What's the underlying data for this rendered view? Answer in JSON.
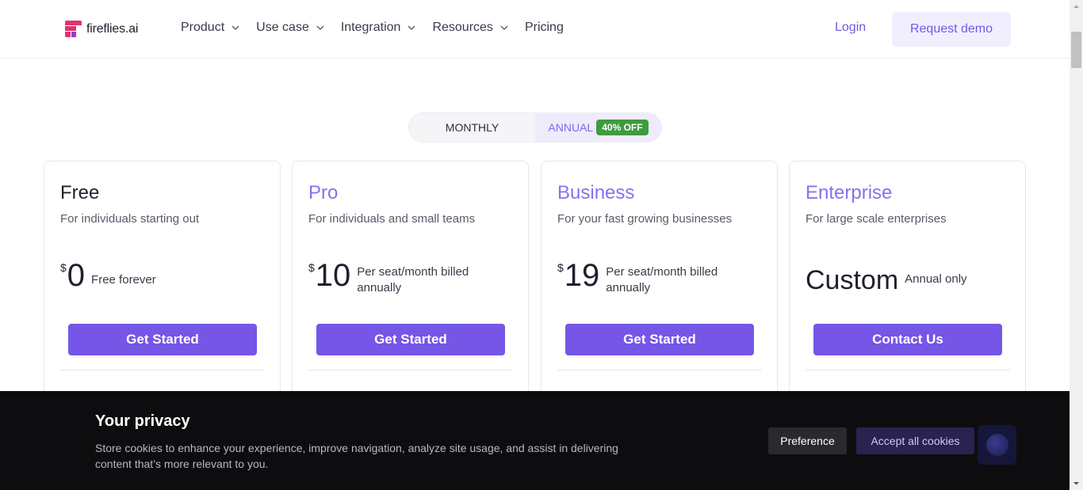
{
  "header": {
    "logo_text": "fireflies.ai",
    "nav": [
      {
        "label": "Product",
        "has_dropdown": true
      },
      {
        "label": "Use case",
        "has_dropdown": true
      },
      {
        "label": "Integration",
        "has_dropdown": true
      },
      {
        "label": "Resources",
        "has_dropdown": true
      },
      {
        "label": "Pricing",
        "has_dropdown": false
      }
    ],
    "login_label": "Login",
    "demo_label": "Request demo"
  },
  "billing_toggle": {
    "monthly_label": "MONTHLY",
    "annual_label": "ANNUAL",
    "discount_badge": "40% OFF",
    "selected": "annual"
  },
  "plans": [
    {
      "title": "Free",
      "title_color": "#1f1f2e",
      "subtitle": "For individuals starting out",
      "currency": "$",
      "price": "0",
      "note": "Free forever",
      "cta": "Get Started"
    },
    {
      "title": "Pro",
      "title_color": "#8b6ff0",
      "subtitle": "For individuals and small teams",
      "currency": "$",
      "price": "10",
      "note": "Per seat/month billed annually",
      "cta": "Get Started"
    },
    {
      "title": "Business",
      "title_color": "#8b6ff0",
      "subtitle": "For your fast growing businesses",
      "currency": "$",
      "price": "19",
      "note": "Per seat/month billed annually",
      "cta": "Get Started"
    },
    {
      "title": "Enterprise",
      "title_color": "#8b6ff0",
      "subtitle": "For large scale enterprises",
      "price_text": "Custom",
      "note": "Annual only",
      "cta": "Contact Us"
    }
  ],
  "cookie_banner": {
    "title": "Your privacy",
    "text": "Store cookies to enhance your experience, improve navigation, analyze site usage, and assist in delivering content that’s more relevant to you.",
    "preference_label": "Preference",
    "accept_label": "Accept all cookies"
  },
  "colors": {
    "accent": "#7556e7",
    "badge_green": "#3f9b3f",
    "logo_pink": "#e0336e"
  }
}
